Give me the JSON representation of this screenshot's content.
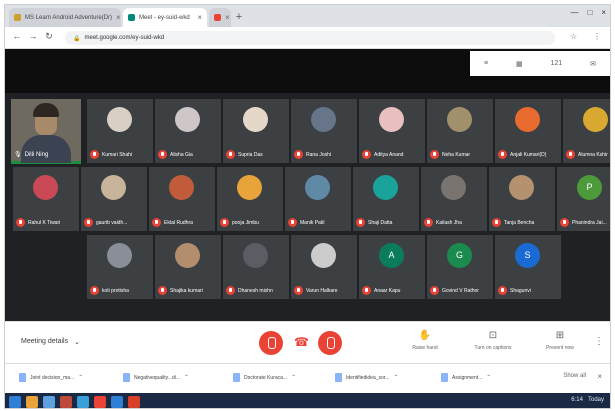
{
  "browser": {
    "tabs": [
      {
        "title": "MS Learn Android Adventure(Dr)",
        "close": "×",
        "favicon_color": "#c8a12a"
      },
      {
        "title": "Meet - ey-suid-wkd",
        "close": "×",
        "favicon_color": "#00897b"
      },
      {
        "title": "",
        "close": "×",
        "favicon_color": "#ea4335"
      }
    ],
    "new_tab": "+",
    "window_controls": [
      "—",
      "□",
      "×"
    ],
    "nav": {
      "back": "←",
      "forward": "→",
      "reload": "↻"
    },
    "address": "meet.google.com/ey-suid-wkd",
    "right_icons": [
      "☆",
      "⋮"
    ]
  },
  "meet": {
    "toolbar": [
      {
        "icon": "≡",
        "name": "captions-icon"
      },
      {
        "icon": "▦",
        "name": "grid-icon"
      },
      {
        "icon": "121",
        "name": "people-count"
      },
      {
        "icon": "✉",
        "name": "chat-icon"
      }
    ],
    "self": {
      "name": "Dilli Ning"
    },
    "participants": [
      {
        "name": "Kumari Shahi",
        "color": "#d8d0c4"
      },
      {
        "name": "Alisha Gia",
        "color": "#cfc6c8"
      },
      {
        "name": "Supria Das",
        "color": "#e6d8c8"
      },
      {
        "name": "Rana Joshi",
        "color": "#66758a"
      },
      {
        "name": "Aditya Anand",
        "color": "#e8c0c0"
      },
      {
        "name": "Neha Kumar",
        "color": "#a0906c"
      },
      {
        "name": "Anjali Kumari(D)",
        "color": "#e86a2e"
      },
      {
        "name": "Alumna Kshir",
        "color": "#d9a830"
      },
      {
        "name": "Rahul K Tiwari",
        "color": "#c94a56"
      },
      {
        "name": "gaurib vaidh...",
        "color": "#c8b49a"
      },
      {
        "name": "Ektal Rudhra",
        "color": "#c05c3a"
      },
      {
        "name": "pooja Jimbu",
        "color": "#e8a33a"
      },
      {
        "name": "Manik Patil",
        "color": "#5f8aa6"
      },
      {
        "name": "Shaji Datta",
        "color": "#1aa39a"
      },
      {
        "name": "Kailash Jha",
        "color": "#7a7470"
      },
      {
        "name": "Tanja Bencha",
        "color": "#b49270"
      },
      {
        "name": "Phanindra Jai...",
        "color": "#4c9a3a"
      },
      {
        "name": "koti protisha",
        "color": "#8a8e96"
      },
      {
        "name": "Shajika kumari",
        "color": "#b38e6c"
      },
      {
        "name": "Dhanesh mishn",
        "color": "#5a5e64"
      },
      {
        "name": "Varun Halkare",
        "color": "#cccccc"
      },
      {
        "name": "Anaar Kapu",
        "color": "#0a7c5c"
      },
      {
        "name": "Govind V Rathor",
        "color": "#1a8a4e"
      },
      {
        "name": "Shagunvi",
        "color": "#1a6ad4"
      }
    ],
    "participant_initials": [
      "",
      "",
      "",
      "",
      "",
      "",
      "",
      "",
      "",
      "",
      "",
      "",
      "",
      "",
      "",
      "",
      "P",
      "",
      "",
      "",
      "",
      "A",
      "G",
      "S"
    ]
  },
  "controls": {
    "meeting_details": "Meeting details",
    "meeting_details_chevron": "⌄",
    "hangup_icon": "☎",
    "present_label": "Raise hand",
    "captions_label": "Turn on captions",
    "present_now_label": "Present now",
    "more_icon": "⋮"
  },
  "downloads": [
    {
      "name": "Joint decision_ma..."
    },
    {
      "name": "Negativequality...di..."
    },
    {
      "name": "Doctorate Kuraca..."
    },
    {
      "name": "Identifiedidea_sor..."
    },
    {
      "name": "Assignment..."
    }
  ],
  "downloads_show_all": "Show all",
  "downloads_close": "×",
  "taskbar": {
    "apps": [
      "#2f7fd6",
      "#e8a33a",
      "#5fa0e0",
      "#c04a3a",
      "#3aa0d8",
      "#ea4335",
      "#2f7fd6",
      "#d8402a"
    ],
    "time": "6:14",
    "date": "Today"
  }
}
